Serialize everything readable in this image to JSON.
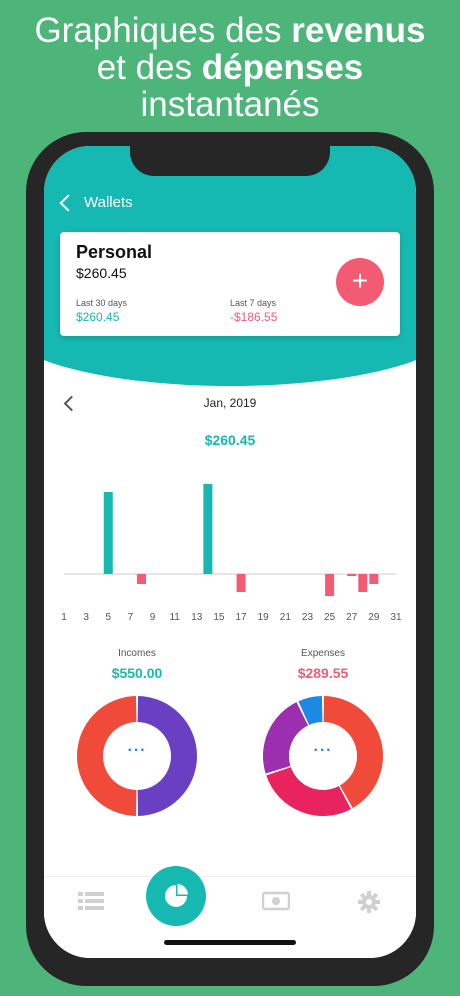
{
  "headline": {
    "line1_a": "Graphiques des ",
    "line1_b": "revenus",
    "line2_a": "et des ",
    "line2_b": "dépenses",
    "line3": "instantanés"
  },
  "nav": {
    "back_label": "Wallets"
  },
  "wallet": {
    "name": "Personal",
    "balance": "$260.45",
    "last30_label": "Last 30 days",
    "last30_value": "$260.45",
    "last7_label": "Last 7 days",
    "last7_value": "-$186.55",
    "add_label": "+"
  },
  "period": {
    "month": "Jan, 2019",
    "total": "$260.45"
  },
  "chart_data": {
    "type": "bar",
    "x": [
      1,
      2,
      3,
      4,
      5,
      6,
      7,
      8,
      9,
      10,
      11,
      12,
      13,
      14,
      15,
      16,
      17,
      18,
      19,
      20,
      21,
      22,
      23,
      24,
      25,
      26,
      27,
      28,
      29,
      30,
      31
    ],
    "tick_labels": [
      "1",
      "3",
      "5",
      "7",
      "9",
      "11",
      "13",
      "15",
      "17",
      "19",
      "21",
      "23",
      "25",
      "27",
      "29",
      "31"
    ],
    "values": [
      0,
      0,
      0,
      0,
      0.82,
      0,
      0,
      -0.1,
      0,
      0,
      0,
      0,
      0,
      0.9,
      0,
      0,
      -0.18,
      0,
      0,
      0,
      0,
      0,
      0,
      0,
      -0.22,
      0,
      -0.02,
      -0.18,
      -0.1,
      0,
      0
    ],
    "colors": {
      "positive": "#16b9b2",
      "negative": "#f35b73"
    }
  },
  "incomes": {
    "title": "Incomes",
    "value": "$550.00",
    "dots": "···",
    "slices": [
      {
        "fraction": 0.5,
        "color": "#6a3fc1"
      },
      {
        "fraction": 0.5,
        "color": "#f04b3a"
      }
    ]
  },
  "expenses": {
    "title": "Expenses",
    "value": "$289.55",
    "dots": "···",
    "slices": [
      {
        "fraction": 0.42,
        "color": "#f04b3a"
      },
      {
        "fraction": 0.28,
        "color": "#e8235f"
      },
      {
        "fraction": 0.23,
        "color": "#9c2fb0"
      },
      {
        "fraction": 0.07,
        "color": "#1e88e5"
      }
    ]
  },
  "colors": {
    "background": "#4db57a",
    "accent": "#16b9b2",
    "negative": "#f35b73"
  },
  "tabs": [
    {
      "icon": "list-icon"
    },
    {
      "icon": "pie-chart-icon"
    },
    {
      "icon": "cash-icon"
    },
    {
      "icon": "gear-icon"
    }
  ]
}
